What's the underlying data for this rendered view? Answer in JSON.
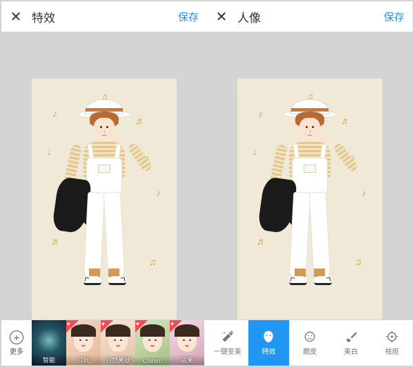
{
  "left": {
    "close": "✕",
    "title": "特效",
    "save": "保存"
  },
  "right": {
    "close": "✕",
    "title": "人像",
    "save": "保存"
  },
  "more_label": "更多",
  "filter_thumbs": [
    {
      "label": "智能"
    },
    {
      "label": "红润"
    },
    {
      "label": "自然美肤"
    },
    {
      "label": "Chihiro"
    },
    {
      "label": "甜美"
    }
  ],
  "tabs": [
    {
      "id": "beautify",
      "label": "一键变美"
    },
    {
      "id": "effects",
      "label": "特效",
      "active": true
    },
    {
      "id": "smooth",
      "label": "磨皮"
    },
    {
      "id": "whiten",
      "label": "美白"
    },
    {
      "id": "acne",
      "label": "祛痘"
    }
  ]
}
